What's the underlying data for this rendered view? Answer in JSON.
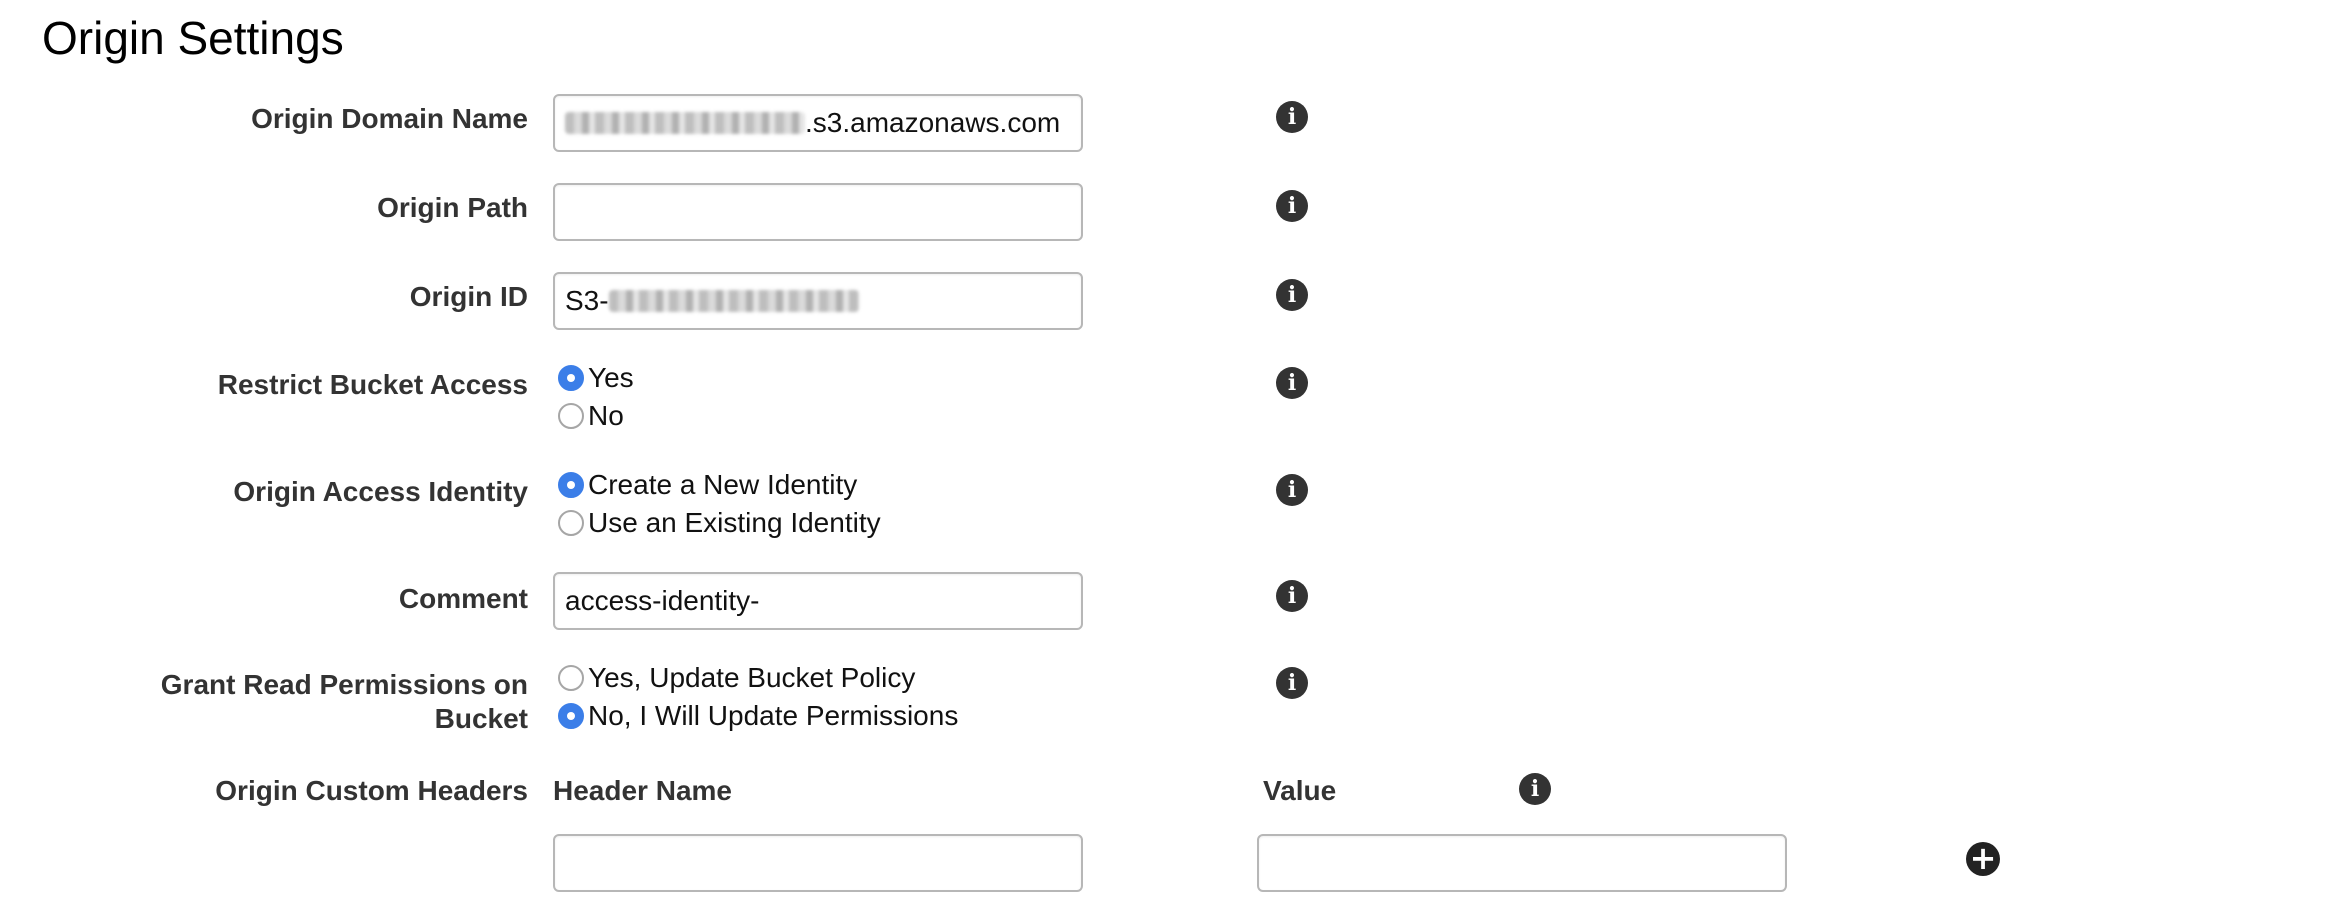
{
  "section": {
    "title": "Origin Settings"
  },
  "fields": {
    "origin_domain_name": {
      "label": "Origin Domain Name",
      "value_suffix": ".s3.amazonaws.com"
    },
    "origin_path": {
      "label": "Origin Path",
      "value": ""
    },
    "origin_id": {
      "label": "Origin ID",
      "value_prefix": "S3-"
    },
    "restrict_bucket_access": {
      "label": "Restrict Bucket Access",
      "options": [
        "Yes",
        "No"
      ],
      "selected": "Yes"
    },
    "origin_access_identity": {
      "label": "Origin Access Identity",
      "options": [
        "Create a New Identity",
        "Use an Existing Identity"
      ],
      "selected": "Create a New Identity"
    },
    "comment": {
      "label": "Comment",
      "value": "access-identity-"
    },
    "grant_read_permissions": {
      "label_line1": "Grant Read Permissions on",
      "label_line2": "Bucket",
      "options": [
        "Yes, Update Bucket Policy",
        "No, I Will Update Permissions"
      ],
      "selected": "No, I Will Update Permissions"
    },
    "custom_headers": {
      "label": "Origin Custom Headers",
      "col_header_name": "Header Name",
      "col_value": "Value",
      "header_name": "",
      "value": ""
    }
  },
  "icons": {
    "info": "info-icon",
    "add": "plus-circle-icon"
  },
  "colors": {
    "radio_selected": "#3b7ee8",
    "info_icon": "#333333"
  }
}
